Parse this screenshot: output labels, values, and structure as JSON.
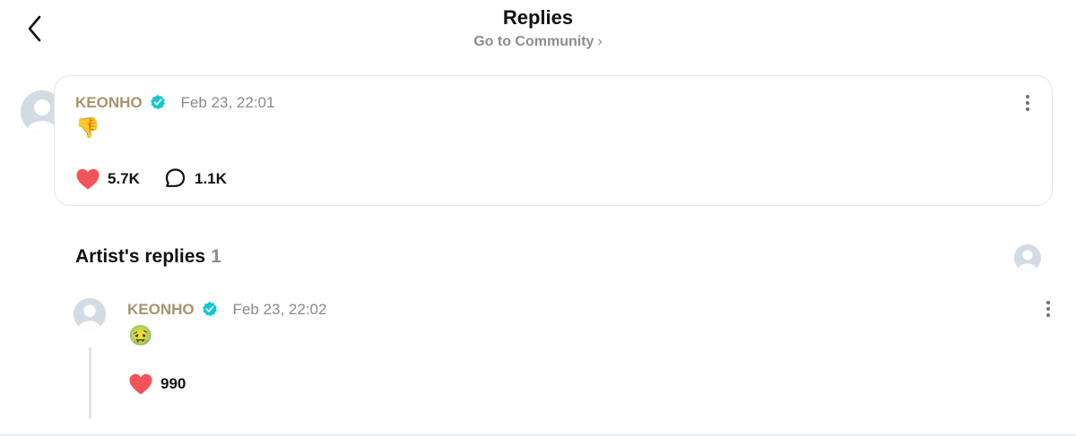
{
  "header": {
    "title": "Replies",
    "subtitle": "Go to Community",
    "subtitle_chevron": "›"
  },
  "post": {
    "author": "KEONHO",
    "date": "Feb 23, 22:01",
    "content": "👎",
    "likes": "5.7K",
    "comments": "1.1K"
  },
  "artist_replies": {
    "label": "Artist's replies",
    "count": "1"
  },
  "reply": {
    "author": "KEONHO",
    "date": "Feb 23, 22:02",
    "content": "🤢",
    "likes": "990"
  },
  "colors": {
    "author": "#a8936a",
    "verified": "#13c6d4",
    "heart": "#f2545b",
    "muted": "#8a8a8a"
  },
  "icons": [
    "back-arrow-icon",
    "chevron-right-icon",
    "avatar-icon",
    "verified-icon",
    "more-icon",
    "heart-icon",
    "comment-icon"
  ]
}
